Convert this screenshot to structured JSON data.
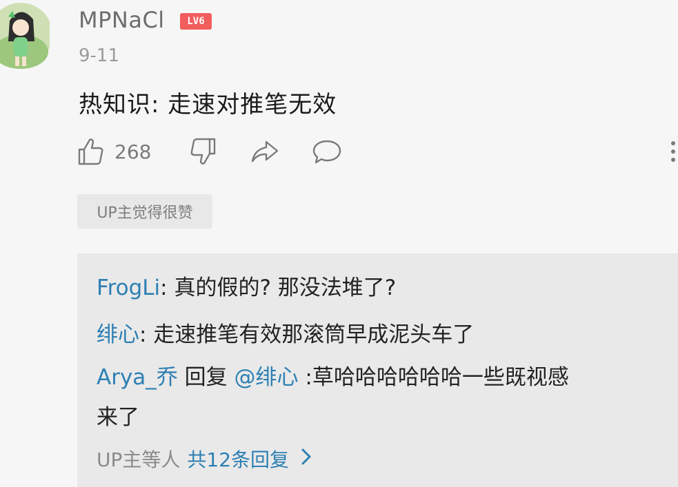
{
  "comment": {
    "username": "MPNaCl",
    "level_badge": "LV6",
    "date": "9-11",
    "text": "热知识: 走速对推笔无效",
    "like_count": "268",
    "up_liked_tag": "UP主觉得很赞"
  },
  "icons": [
    "thumbs-up-icon",
    "thumbs-down-icon",
    "share-icon",
    "comment-icon",
    "more-vertical-icon",
    "chevron-right-icon"
  ],
  "colors": {
    "link": "#2c7fb3",
    "badge": "#f25d5d"
  },
  "replies": [
    {
      "name": "FrogLi",
      "sep": ": ",
      "text": "真的假的? 那没法堆了?"
    },
    {
      "name": "绯心",
      "sep": ": ",
      "text": "走速推笔有效那滚筒早成泥头车了"
    },
    {
      "name": "Arya_乔",
      "reply_word": " 回复 ",
      "mention": "@绯心",
      "text_line1": " :草哈哈哈哈哈哈一些既视感",
      "text_line2": "来了"
    }
  ],
  "replies_footer": {
    "prefix": "UP主等人",
    "total": "共12条回复"
  }
}
